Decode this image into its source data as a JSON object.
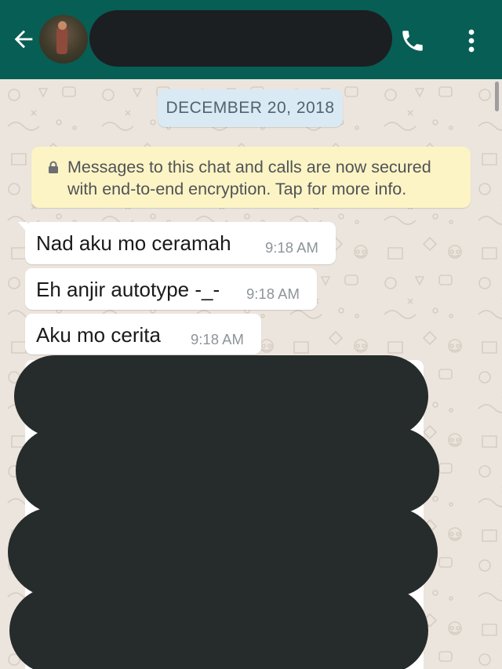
{
  "header": {
    "back_icon": "arrow-left-icon",
    "call_icon": "phone-icon",
    "more_icon": "more-vertical-icon",
    "bg_color": "#075e54"
  },
  "chat": {
    "date": "DECEMBER 20, 2018",
    "encryption": {
      "icon": "lock-icon",
      "line1": "Messages to this chat and calls are now secured",
      "line2": "with end-to-end encryption. Tap for more info."
    },
    "messages": [
      {
        "text": "Nad aku mo ceramah",
        "time": "9:18 AM"
      },
      {
        "text": "Eh anjir autotype -_-",
        "time": "9:18 AM"
      },
      {
        "text": "Aku mo cerita",
        "time": "9:18 AM"
      }
    ]
  }
}
